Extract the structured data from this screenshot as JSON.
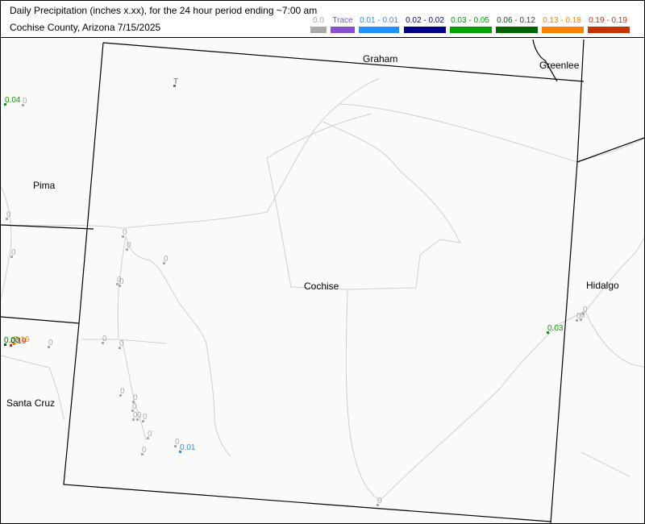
{
  "title": {
    "line1": "Daily Precipitation (inches  x.xx),  for the 24 hour period ending ~7:00 am",
    "line2": "Cochise County, Arizona  7/15/2025"
  },
  "legend": [
    {
      "label": "0.0",
      "color": "#aaaaaa"
    },
    {
      "label": "Trace",
      "color": "#8a4fcf"
    },
    {
      "label": "0.01 - 0.01",
      "color": "#1e90ff"
    },
    {
      "label": "0.02 - 0.02",
      "color": "#000088"
    },
    {
      "label": "0.03 - 0.05",
      "color": "#00a000"
    },
    {
      "label": "0.06 - 0.12",
      "color": "#006400"
    },
    {
      "label": "0.13 - 0.18",
      "color": "#ff7f00"
    },
    {
      "label": "0.19 - 0.19",
      "color": "#c83200"
    }
  ],
  "counties": [
    {
      "name": "Graham"
    },
    {
      "name": "Greenlee"
    },
    {
      "name": "Pima"
    },
    {
      "name": "Cochise"
    },
    {
      "name": "Hidalgo"
    },
    {
      "name": "Santa Cruz"
    }
  ],
  "stations": [
    {
      "text": "T",
      "class": 1
    },
    {
      "text": "0.04",
      "class": 4
    },
    {
      "text": "0",
      "class": 0
    },
    {
      "text": "0",
      "class": 0
    },
    {
      "text": "0",
      "class": 0
    },
    {
      "text": "0",
      "class": 0
    },
    {
      "text": "0",
      "class": 0
    },
    {
      "text": "0",
      "class": 0
    },
    {
      "text": "0",
      "class": 0
    },
    {
      "text": "0",
      "class": 0
    },
    {
      "text": "0",
      "class": 0
    },
    {
      "text": "0",
      "class": 0
    },
    {
      "text": "0",
      "class": 0
    },
    {
      "text": "0",
      "class": 0
    },
    {
      "text": "0",
      "class": 0
    },
    {
      "text": "0",
      "class": 0
    },
    {
      "text": "0",
      "class": 0
    },
    {
      "text": "0",
      "class": 0
    },
    {
      "text": "0",
      "class": 0
    },
    {
      "text": "0",
      "class": 0
    },
    {
      "text": "0",
      "class": 0
    },
    {
      "text": "0",
      "class": 0
    },
    {
      "text": "0.01",
      "class": 2
    },
    {
      "text": "0.03",
      "class": 4
    },
    {
      "text": "0",
      "class": 0
    },
    {
      "text": "0",
      "class": 0
    },
    {
      "text": "0",
      "class": 0
    },
    {
      "text": "0",
      "class": 0
    },
    {
      "text": "0.16",
      "class": 6
    },
    {
      "text": "0.19",
      "class": 7
    },
    {
      "text": "0.00",
      "class": 5
    }
  ]
}
